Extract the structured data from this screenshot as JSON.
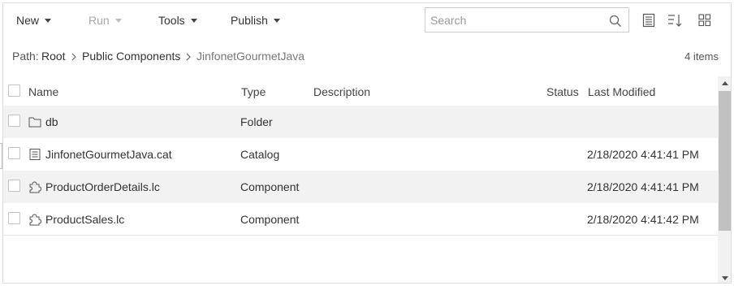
{
  "toolbar": {
    "new_label": "New",
    "run_label": "Run",
    "tools_label": "Tools",
    "publish_label": "Publish",
    "search_placeholder": "Search",
    "search_value": ""
  },
  "path": {
    "prefix": "Path:",
    "parts": [
      "Root",
      "Public Components",
      "JinfonetGourmetJava"
    ],
    "count": "4 items"
  },
  "columns": {
    "name": "Name",
    "type": "Type",
    "description": "Description",
    "status": "Status",
    "modified": "Last Modified"
  },
  "rows": [
    {
      "icon": "folder-icon",
      "name": "db",
      "type": "Folder",
      "description": "",
      "status": "",
      "modified": ""
    },
    {
      "icon": "catalog-icon",
      "name": "JinfonetGourmetJava.cat",
      "type": "Catalog",
      "description": "",
      "status": "",
      "modified": "2/18/2020 4:41:41 PM"
    },
    {
      "icon": "component-icon",
      "name": "ProductOrderDetails.lc",
      "type": "Component",
      "description": "",
      "status": "",
      "modified": "2/18/2020 4:41:41 PM"
    },
    {
      "icon": "component-icon",
      "name": "ProductSales.lc",
      "type": "Component",
      "description": "",
      "status": "",
      "modified": "2/18/2020 4:41:42 PM"
    }
  ],
  "colors": {
    "row_alt": "#f2f2f2",
    "text": "#333333",
    "disabled": "#a8a8a8",
    "border": "#dcdcdc"
  }
}
